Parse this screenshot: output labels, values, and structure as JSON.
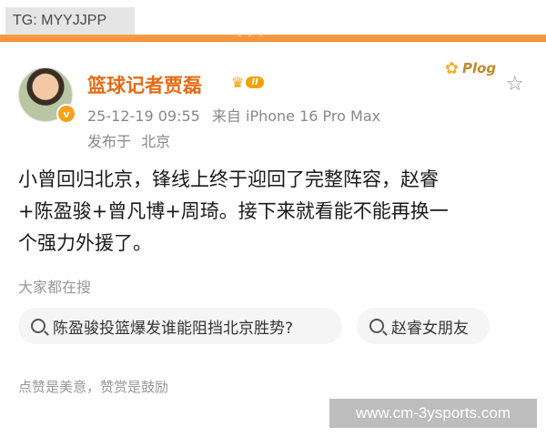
{
  "watermark_tag": "TG: MYYJJPP",
  "post": {
    "username": "篮球记者贾磊",
    "level_badge": "II",
    "sticker_text": "Plog",
    "timestamp": "25-12-19 09:55",
    "source": "来自 iPhone 16 Pro Max",
    "location_label": "发布于",
    "location_city": "北京",
    "text_line1": "小曾回归北京，锋线上终于迎回了完整阵容，赵睿",
    "text_line2": "+陈盈骏+曾凡博+周琦。接下来就看能不能再换一",
    "text_line3": "个强力外援了。"
  },
  "search": {
    "heading": "大家都在搜",
    "chips": [
      {
        "label": "陈盈骏投篮爆发谁能阻挡北京胜势?"
      },
      {
        "label": "赵睿女朋友"
      }
    ]
  },
  "footer_note": "点赞是美意，赞赏是鼓励",
  "site_watermark": "www.cm-3ysports.com",
  "colors": {
    "username": "#e66b16",
    "accent_strip": "#f58b2e",
    "meta_text": "#888888"
  },
  "icons": {
    "verified": "verified-badge-icon",
    "crown": "crown-icon",
    "favorite": "star-icon",
    "search": "search-icon"
  }
}
